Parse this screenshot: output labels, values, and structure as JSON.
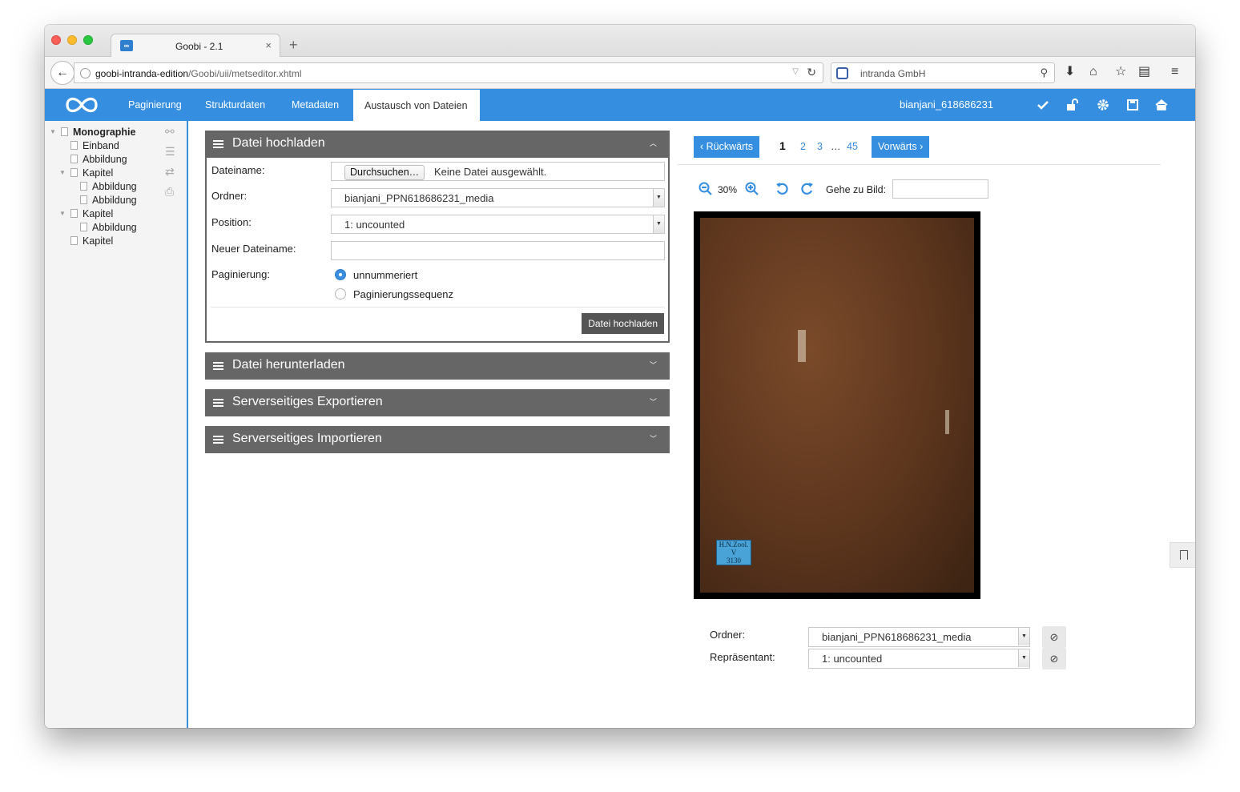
{
  "browser": {
    "tab_title": "Goobi - 2.1",
    "tab_favicon": "∞",
    "tab_close": "×",
    "new_tab": "+",
    "url_host": "goobi-intranda-edition",
    "url_path": "/Goobi/uii/metseditor.xhtml",
    "search_text": "intranda GmbH"
  },
  "app": {
    "nav": [
      "Paginierung",
      "Strukturdaten",
      "Metadaten",
      "Austausch von Dateien"
    ],
    "active_nav": "Austausch von Dateien",
    "record_id": "bianjani_618686231",
    "accent": "#368ee0"
  },
  "tree": {
    "root": "Monographie",
    "items": [
      "Einband",
      "Abbildung",
      "Kapitel",
      "Abbildung",
      "Abbildung",
      "Kapitel",
      "Abbildung",
      "Kapitel"
    ]
  },
  "upload": {
    "title": "Datei hochladen",
    "filename_label": "Dateiname:",
    "browse_label": "Durchsuchen…",
    "no_file": "Keine Datei ausgewählt.",
    "folder_label": "Ordner:",
    "folder_value": "bianjani_PPN618686231_media",
    "position_label": "Position:",
    "position_value": "1: uncounted",
    "newname_label": "Neuer Dateiname:",
    "pagination_label": "Paginierung:",
    "radio_1": "unnummeriert",
    "radio_2": "Paginierungssequenz",
    "submit": "Datei hochladen"
  },
  "panels": {
    "download": "Datei herunterladen",
    "export": "Serverseitiges Exportieren",
    "import": "Serverseitiges Importieren"
  },
  "viewer": {
    "back": "Rückwärts",
    "forward": "Vorwärts",
    "pages": [
      "1",
      "2",
      "3",
      "…",
      "45"
    ],
    "current_page": "1",
    "zoom": "30%",
    "goto_label": "Gehe zu Bild:",
    "scan_label_line1": "H.N.Zool.",
    "scan_label_line2": "V",
    "scan_label_line3": "3130"
  },
  "bottom": {
    "folder_label": "Ordner:",
    "folder_value": "bianjani_PPN618686231_media",
    "rep_label": "Repräsentant:",
    "rep_value": "1: uncounted"
  }
}
